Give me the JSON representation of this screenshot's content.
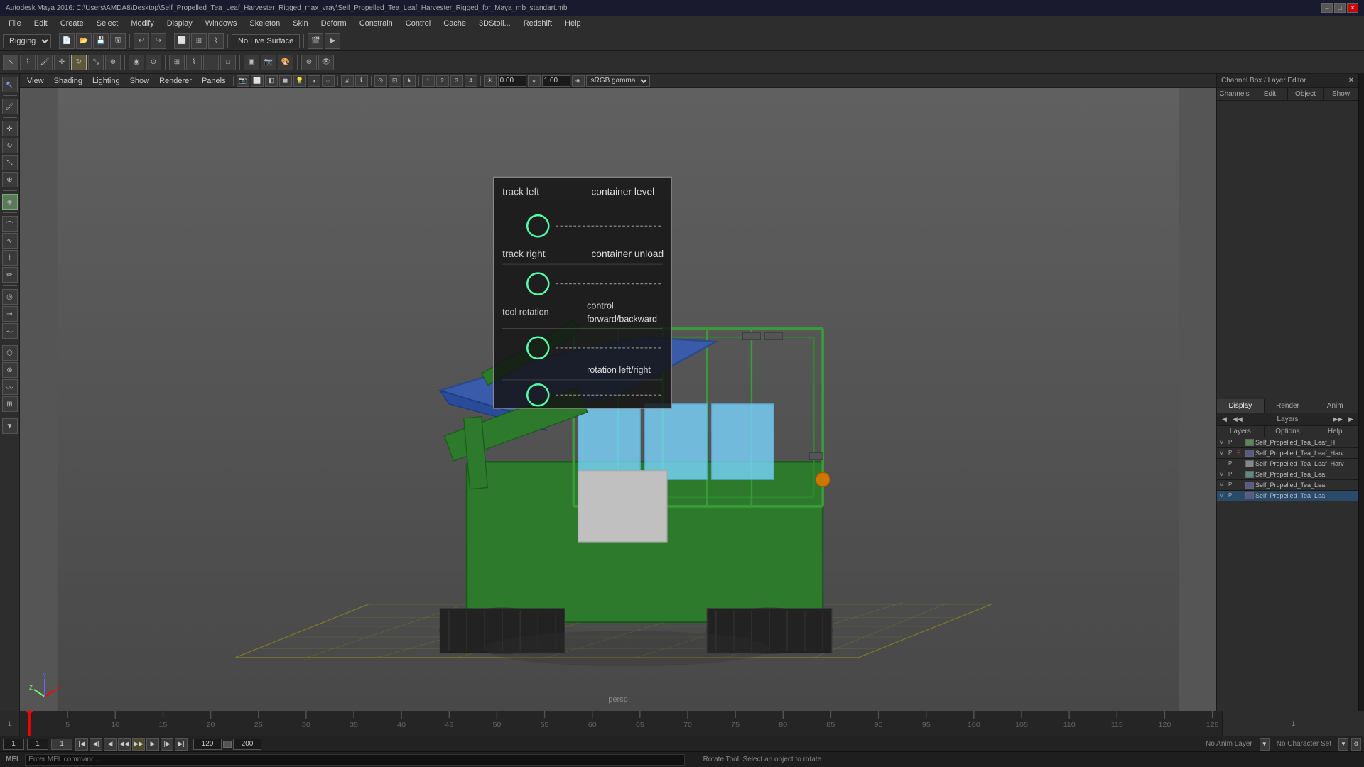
{
  "title": "Autodesk Maya 2016: C:\\Users\\AMDA8\\Desktop\\Self_Propelled_Tea_Leaf_Harvester_Rigged_max_vray\\Self_Propelled_Tea_Leaf_Harvester_Rigged_for_Maya_mb_standart.mb",
  "window_controls": {
    "minimize": "–",
    "maximize": "□",
    "close": "✕"
  },
  "menu": {
    "items": [
      "File",
      "Edit",
      "Create",
      "Select",
      "Modify",
      "Display",
      "Windows",
      "Skeleton",
      "Skin",
      "Deform",
      "Skeleton",
      "Constrain",
      "Control",
      "Cache",
      "3DStoli...",
      "Redshift",
      "Help"
    ]
  },
  "toolbar1": {
    "mode_select": "Rigging",
    "no_live_surface": "No Live Surface"
  },
  "viewport": {
    "menus": [
      "View",
      "Shading",
      "Lighting",
      "Show",
      "Renderer",
      "Panels"
    ],
    "value1": "0.00",
    "value2": "1.00",
    "gamma": "sRGB gamma",
    "persp_label": "persp"
  },
  "info_board": {
    "rows": [
      {
        "label": "track left",
        "value": "container level"
      },
      {
        "label": "",
        "value": ""
      },
      {
        "label": "track right",
        "value": "container unload"
      },
      {
        "label": "",
        "value": ""
      },
      {
        "label": "tool rotation",
        "value": "control forward/backward"
      },
      {
        "label": "",
        "value": ""
      },
      {
        "label": "",
        "value": "rotation left/right"
      }
    ]
  },
  "right_panel": {
    "title": "Channel Box / Layer Editor",
    "tabs": [
      "Channels",
      "Edit",
      "Object",
      "Show"
    ]
  },
  "dra_tabs": {
    "items": [
      "Display",
      "Render",
      "Anim"
    ]
  },
  "layers": {
    "title": "Layers",
    "sub_tabs": [
      "Layers",
      "Options",
      "Help"
    ],
    "items": [
      {
        "v": "V",
        "p": "P",
        "r": "",
        "color": "#5a8a5a",
        "name": "Self_Propelled_Tea_Leaf_H"
      },
      {
        "v": "V",
        "p": "P",
        "r": "R",
        "color": "#5a5a8a",
        "name": "Self_Propelled_Tea_Leaf_Harv"
      },
      {
        "v": "",
        "p": "P",
        "r": "",
        "color": "#888",
        "name": "Self_Propelled_Tea_Leaf_Harv"
      },
      {
        "v": "V",
        "p": "P",
        "r": "",
        "color": "#5a8a8a",
        "name": "Self_Propelled_Tea_Lea"
      },
      {
        "v": "V",
        "p": "P",
        "r": "",
        "color": "#5a5a8a",
        "name": "Self_Propelled_Tea_Lea"
      },
      {
        "v": "V",
        "p": "P",
        "r": "",
        "color": "#5a5a8a",
        "name": "Self_Propelled_Tea_Lea",
        "selected": true
      }
    ]
  },
  "timeline": {
    "ticks": [
      1,
      5,
      10,
      15,
      20,
      25,
      30,
      35,
      40,
      45,
      50,
      55,
      60,
      65,
      70,
      75,
      80,
      85,
      90,
      95,
      100,
      105,
      110,
      115,
      120,
      125
    ],
    "start": 1,
    "end": 120,
    "current": 1,
    "range_start": 1,
    "range_end": 120,
    "total_end": 200
  },
  "status_bar": {
    "frame1": "1",
    "frame2": "1",
    "frame3": "1",
    "frame_current": "120",
    "anim_layer": "No Anim Layer",
    "char_set": "No Character Set",
    "mel_label": "MEL",
    "status_message": "Rotate Tool: Select an object to rotate."
  },
  "playback": {
    "btn_start": "⏮",
    "btn_prev_key": "⏪",
    "btn_prev": "◀",
    "btn_play_back": "◀",
    "btn_play": "▶",
    "btn_next": "▶",
    "btn_next_key": "⏩",
    "btn_end": "⏭"
  }
}
